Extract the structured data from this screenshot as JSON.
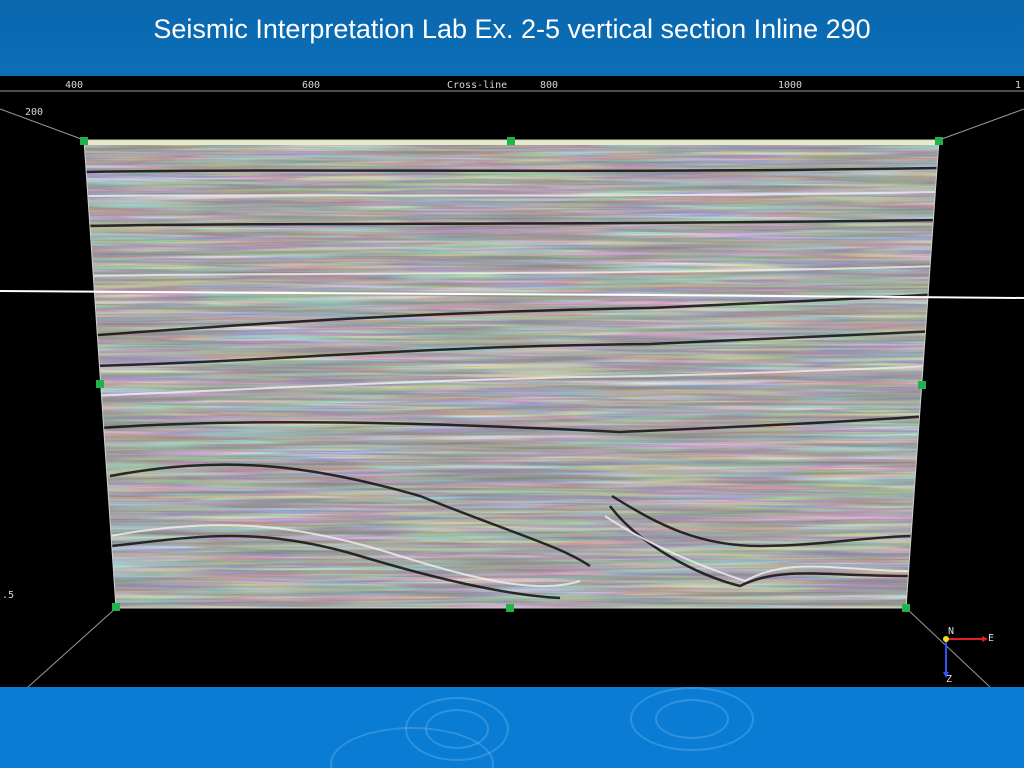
{
  "slide": {
    "title": "Seismic Interpretation Lab Ex. 2-5 vertical section Inline 290"
  },
  "viewer": {
    "axis_title": "Cross-line",
    "top_ticks": [
      "400",
      "600",
      "800",
      "1000",
      "1"
    ],
    "left_ticks": [
      "200",
      ".5"
    ],
    "compass": {
      "north": "N",
      "east": "E",
      "down": "Z"
    },
    "colors": {
      "background": "#000000",
      "handle": "#22b24c",
      "horizon_line": "#ffffff",
      "top_band": "#e6ecc8",
      "compass_north": "#f0e020",
      "compass_east": "#e02020",
      "compass_down": "#3050ff"
    }
  }
}
